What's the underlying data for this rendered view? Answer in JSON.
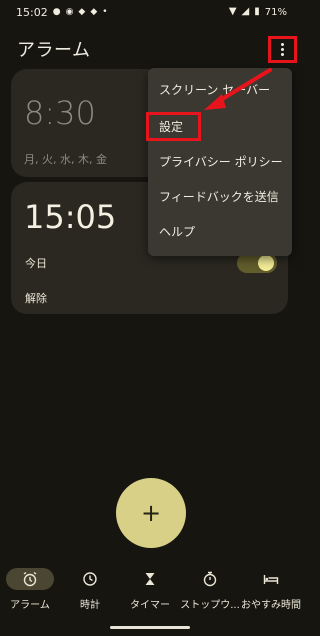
{
  "status_bar": {
    "time": "15:02",
    "battery": "71%"
  },
  "app": {
    "title": "アラーム"
  },
  "alarms": [
    {
      "time": "8:30",
      "days": "月, 火, 水, 木, 金"
    },
    {
      "time": "15:05",
      "when": "今日",
      "dismiss": "解除",
      "enabled": true
    }
  ],
  "menu": {
    "items": [
      "スクリーン セーバー",
      "設定",
      "プライバシー ポリシー",
      "フィードバックを送信",
      "ヘルプ"
    ]
  },
  "fab": {
    "label": "+"
  },
  "bottom_nav": {
    "items": [
      {
        "label": "アラーム",
        "icon": "alarm-clock-icon",
        "active": true
      },
      {
        "label": "時計",
        "icon": "clock-icon",
        "active": false
      },
      {
        "label": "タイマー",
        "icon": "hourglass-icon",
        "active": false
      },
      {
        "label": "ストップウ...",
        "icon": "stopwatch-icon",
        "active": false
      },
      {
        "label": "おやすみ時間",
        "icon": "bed-icon",
        "active": false
      }
    ]
  },
  "colors": {
    "background": "#161510",
    "card": "#2a2820",
    "accent": "#d8d086",
    "annotation_red": "#e8141c"
  }
}
